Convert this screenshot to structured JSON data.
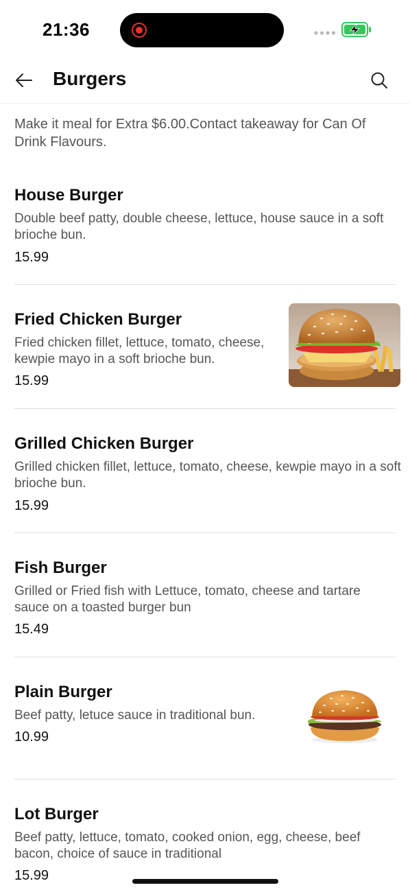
{
  "status_bar": {
    "time": "21:36"
  },
  "header": {
    "title": "Burgers"
  },
  "category_note": "Make it meal for Extra $6.00.Contact takeaway for Can Of Drink Flavours.",
  "items": [
    {
      "name": "House Burger",
      "description": "Double beef patty, double cheese, lettuce, house sauce in a soft brioche bun.",
      "price": "15.99"
    },
    {
      "name": "Fried Chicken Burger",
      "description": "Fried chicken fillet, lettuce, tomato, cheese, kewpie mayo in a soft brioche bun.",
      "price": "15.99",
      "image": "fried-chicken-burger-photo"
    },
    {
      "name": "Grilled Chicken Burger",
      "description": "Grilled chicken fillet, lettuce, tomato, cheese, kewpie mayo in a soft brioche bun.",
      "price": "15.99"
    },
    {
      "name": "Fish Burger",
      "description": "Grilled or Fried fish with Lettuce, tomato, cheese and tartare sauce on a toasted burger bun",
      "price": "15.49"
    },
    {
      "name": "Plain Burger",
      "description": "Beef patty, letuce sauce in traditional bun.",
      "price": "10.99",
      "image": "plain-burger-photo"
    },
    {
      "name": "Lot Burger",
      "description": "Beef patty, lettuce, tomato, cooked onion, egg, cheese, beef bacon, choice of sauce in traditional",
      "price": "15.99"
    }
  ],
  "icons": {
    "back": "arrow-left-icon",
    "search": "search-icon",
    "recording": "record-icon",
    "battery": "battery-charging-icon"
  },
  "colors": {
    "recording": "#e8332f",
    "battery": "#34c759",
    "text_primary": "#111111",
    "text_secondary": "#555555",
    "divider": "#dedede"
  }
}
